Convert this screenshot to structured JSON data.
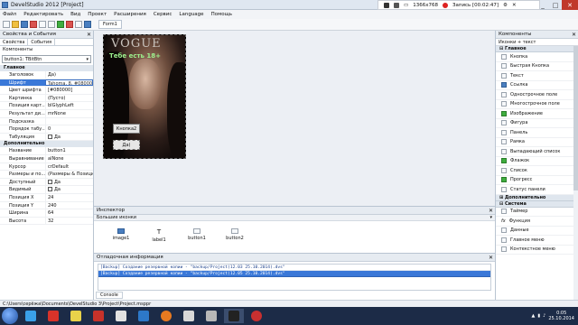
{
  "window": {
    "title": "DevelStudio 2012 [Project]"
  },
  "recorder": {
    "resolution": "1366x768",
    "record_label": "Запись [00:02:47]"
  },
  "menu": [
    "Файл",
    "Редактировать",
    "Вид",
    "Проект",
    "Расширения",
    "Сервис",
    "Language",
    "Помощь"
  ],
  "toolbar": {
    "form_tab": "Form1"
  },
  "left_panel": {
    "title": "Свойства и События",
    "tabs": [
      "Свойства",
      "События"
    ],
    "components_label": "Компоненты",
    "selected_component": "button1: TBitBtn",
    "groups": [
      {
        "name": "Главное",
        "rows": [
          {
            "name": "Заголовок",
            "value": "Да)"
          },
          {
            "name": "Шрифт",
            "value": "Tahoma, 8, #080000"
          },
          {
            "name": "Цвет шрифта",
            "value": "[#080000]"
          },
          {
            "name": "Картинка",
            "value": "(Пусто)"
          },
          {
            "name": "Позиция карт...",
            "value": "blGlyphLeft"
          },
          {
            "name": "Результат ди...",
            "value": "mrNone"
          },
          {
            "name": "Подсказка",
            "value": ""
          },
          {
            "name": "Порядок табу...",
            "value": "0"
          },
          {
            "name": "Табуляция",
            "value": "Да"
          }
        ]
      },
      {
        "name": "Дополнительно",
        "rows": [
          {
            "name": "Название",
            "value": "button1"
          },
          {
            "name": "Выравнивание",
            "value": "alNone"
          },
          {
            "name": "Курсор",
            "value": "crDefault"
          },
          {
            "name": "Размеры и по...",
            "value": "(Размеры & Позиция)"
          },
          {
            "name": "Доступный",
            "value": "Да"
          },
          {
            "name": "Видимый",
            "value": "Да"
          },
          {
            "name": "Позиция X",
            "value": "24"
          },
          {
            "name": "Позиция Y",
            "value": "240"
          },
          {
            "name": "Ширина",
            "value": "64"
          },
          {
            "name": "Высота",
            "value": "32"
          }
        ]
      }
    ]
  },
  "form": {
    "masthead": "VOGUE",
    "overlay_text": "Тебе есть 18+",
    "button_question": "Кнопка2",
    "button_yes": "Да)"
  },
  "inspector": {
    "title": "Инспектор",
    "subtitle": "Большие иконки",
    "items": [
      "image1",
      "label1",
      "button1",
      "button2"
    ]
  },
  "debug": {
    "title": "Отладочная информация",
    "lines": [
      "[Backup] Создание резервной копии - \"backup/Project(12.03 25.10.2014).dvs\"",
      "[Backup] Создание резервной копии - \"backup/Project(12.05 25.10.2014).dvs\""
    ],
    "console_tab": "Console"
  },
  "right_panel": {
    "title": "Компоненты",
    "view_mode": "Иконки + текст",
    "group_main": "Главное",
    "items_main": [
      "Кнопка",
      "Быстрая Кнопка",
      "Текст",
      "Ссылка",
      "Однострочное поле",
      "Многострочное поле",
      "Изображение",
      "Фигура",
      "Панель",
      "Рамка",
      "Выпадающий список",
      "Флажок",
      "Список",
      "Прогресс",
      "Статус панели"
    ],
    "group_extra": "Дополнительно",
    "group_system": "Система",
    "items_system": [
      "Таймер",
      "Функция",
      "Данные",
      "Главное меню",
      "Контекстное меню"
    ]
  },
  "status": {
    "path": "C:\\Users\\серёжа\\Documents\\DevelStudio 3\\Project\\Project.msppr"
  },
  "taskbar": {
    "time": "0:05",
    "date": "25.10.2014"
  }
}
